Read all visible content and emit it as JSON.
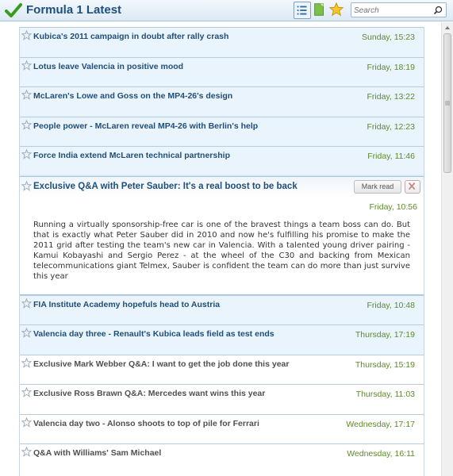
{
  "header": {
    "title": "Formula 1 Latest",
    "search_placeholder": "Search",
    "icons": [
      "check-icon",
      "list-view-icon",
      "feed-icon",
      "star-icon",
      "search-icon"
    ]
  },
  "colors": {
    "title": "#1e4f7e",
    "unread_bg": "#eaf4fc",
    "date": "#5c8a2a"
  },
  "items": [
    {
      "title": "Kubica's 2011 campaign in doubt after rally crash",
      "date": "Sunday, 15:23",
      "state": "unread"
    },
    {
      "title": "Lotus leave Valencia in positive mood",
      "date": "Friday, 18:19",
      "state": "unread"
    },
    {
      "title": "McLaren's Lowe and Goss on the MP4-26's design",
      "date": "Friday, 13:22",
      "state": "unread"
    },
    {
      "title": "People power - McLaren reveal MP4-26 with Berlin's help",
      "date": "Friday, 12:23",
      "state": "unread"
    },
    {
      "title": "Force India extend McLaren technical partnership",
      "date": "Friday, 11:46",
      "state": "unread"
    },
    {
      "title": "FIA Institute Academy hopefuls head to Austria",
      "date": "Friday, 10:48",
      "state": "unread"
    },
    {
      "title": "Valencia day three - Renault's Kubica leads field as test ends",
      "date": "Thursday, 17:19",
      "state": "unread"
    },
    {
      "title": "Exclusive Mark Webber Q&A: I want to get the job done this year",
      "date": "Thursday, 15:19",
      "state": "read"
    },
    {
      "title": "Exclusive Ross Brawn Q&A: Mercedes want wins this year",
      "date": "Thursday, 11:03",
      "state": "read"
    },
    {
      "title": "Valencia day two - Alonso shoots to top of pile for Ferrari",
      "date": "Wednesday, 17:17",
      "state": "read"
    },
    {
      "title": "Q&A with Williams' Sam Michael",
      "date": "Wednesday, 16:11",
      "state": "read"
    }
  ],
  "expanded": {
    "title": "Exclusive Q&A with Peter Sauber: It's a real boost to be back",
    "date": "Friday, 10:56",
    "mark_read_label": "Mark read",
    "body": "Running a virtually sponsorship-free car is one of the bravest things a team boss can do. But that is exactly what Peter Sauber did in 2010 and now he's fulfilling his promise to make the 2011 grid after testing the team's new car in Valencia. With a talented young driver pairing - Kamui Kobayashi and Sergio Perez - at the wheel of the C30 and backing from Mexican telecommunications giant Telmex, Sauber is confident the team can do more than just survive this year"
  }
}
